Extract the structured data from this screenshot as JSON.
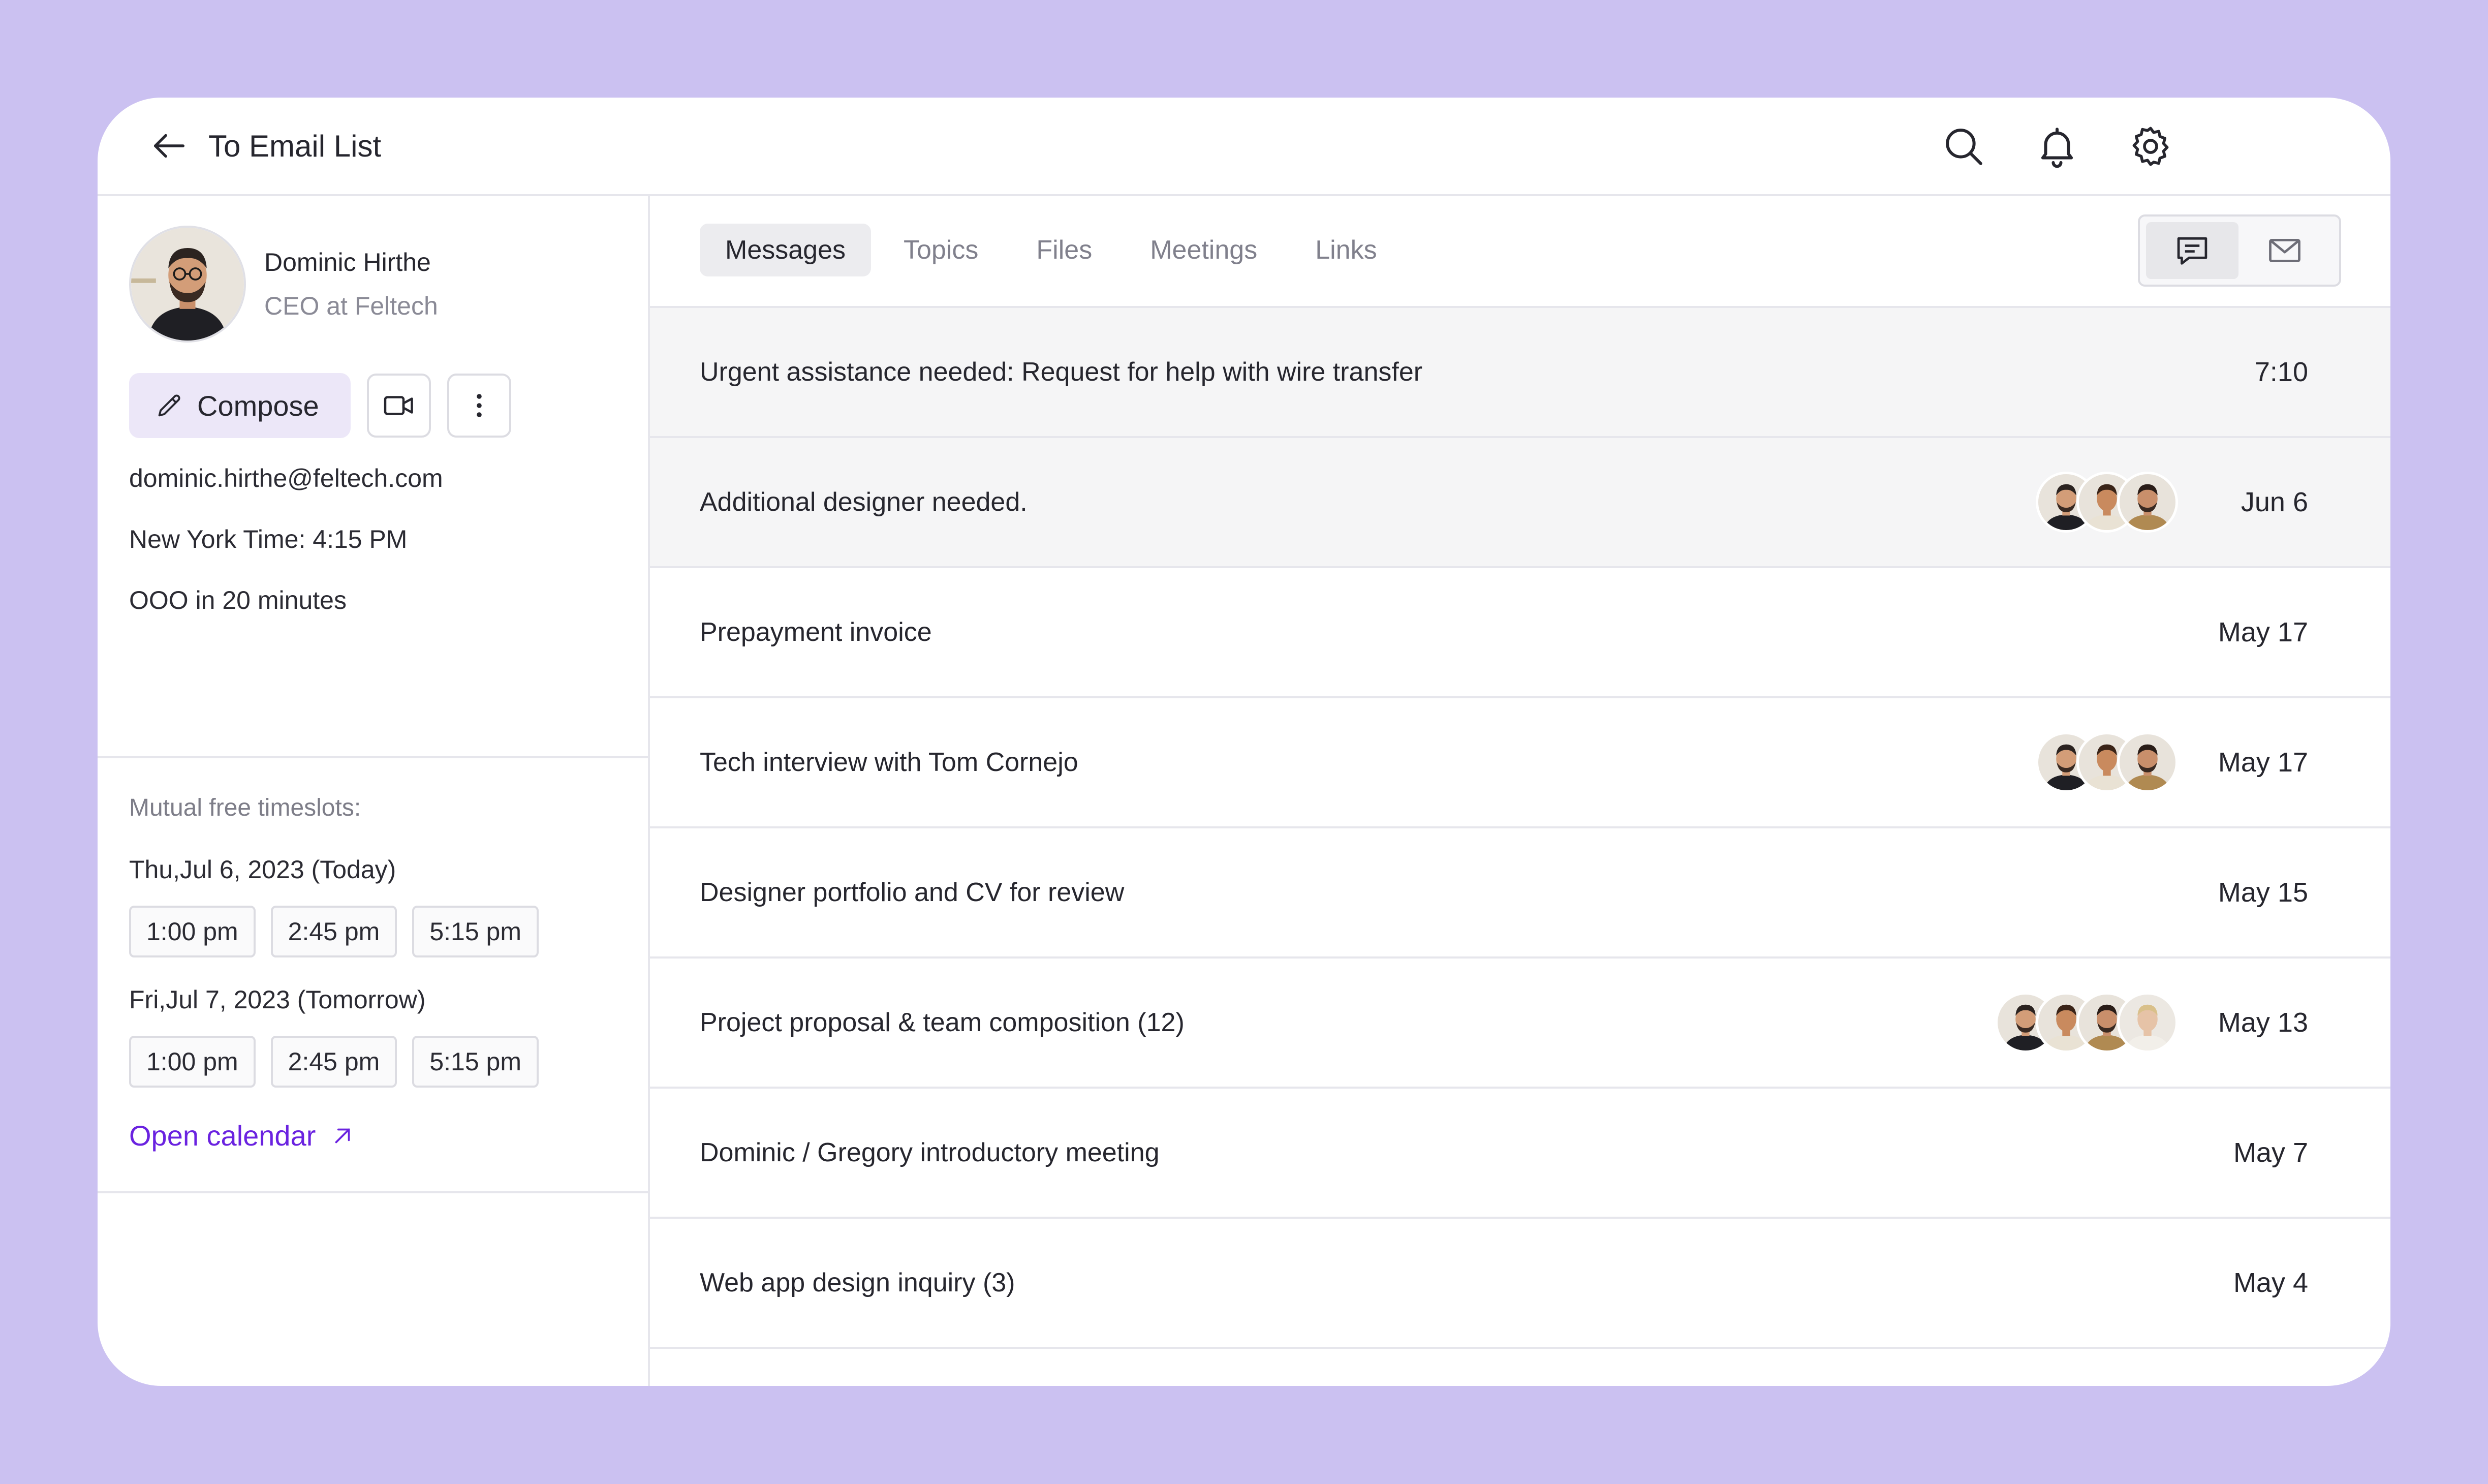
{
  "header": {
    "back_label": "To Email List",
    "icons": [
      "arrow-left-icon",
      "search-icon",
      "bell-icon",
      "gear-icon"
    ]
  },
  "profile": {
    "name": "Dominic Hirthe",
    "role": "CEO at Feltech",
    "compose_label": "Compose",
    "email": "dominic.hirthe@feltech.com",
    "local_time": "New York Time: 4:15 PM",
    "status": "OOO in 20 minutes"
  },
  "timeslots": {
    "label": "Mutual free timeslots:",
    "days": [
      {
        "date": "Thu,Jul 6, 2023 (Today)",
        "slots": [
          "1:00 pm",
          "2:45 pm",
          "5:15 pm"
        ]
      },
      {
        "date": "Fri,Jul 7, 2023 (Tomorrow)",
        "slots": [
          "1:00 pm",
          "2:45 pm",
          "5:15 pm"
        ]
      }
    ],
    "open_calendar": "Open calendar"
  },
  "tabs": [
    {
      "label": "Messages",
      "active": true
    },
    {
      "label": "Topics",
      "active": false
    },
    {
      "label": "Files",
      "active": false
    },
    {
      "label": "Meetings",
      "active": false
    },
    {
      "label": "Links",
      "active": false
    }
  ],
  "view_toggle": {
    "selected": "chat-icon",
    "options": [
      "chat-icon",
      "mail-icon"
    ]
  },
  "messages": [
    {
      "subject": "Urgent assistance needed: Request for help with wire transfer",
      "date": "7:10",
      "participants": 0
    },
    {
      "subject": "Additional designer needed.",
      "date": "Jun 6",
      "participants": 3
    },
    {
      "subject": "Prepayment invoice",
      "date": "May 17",
      "participants": 0
    },
    {
      "subject": "Tech interview with Tom Cornejo",
      "date": "May 17",
      "participants": 3
    },
    {
      "subject": "Designer portfolio and CV for review",
      "date": "May 15",
      "participants": 0
    },
    {
      "subject": "Project proposal & team composition (12)",
      "date": "May 13",
      "participants": 4
    },
    {
      "subject": "Dominic / Gregory introductory meeting",
      "date": "May 7",
      "participants": 0
    },
    {
      "subject": "Web app design inquiry (3)",
      "date": "May 4",
      "participants": 0
    }
  ],
  "colors": {
    "background": "#cbc1f1",
    "accent": "#6a22e0",
    "compose_bg": "#ece7f8",
    "row_shaded": "#f5f5f6"
  }
}
